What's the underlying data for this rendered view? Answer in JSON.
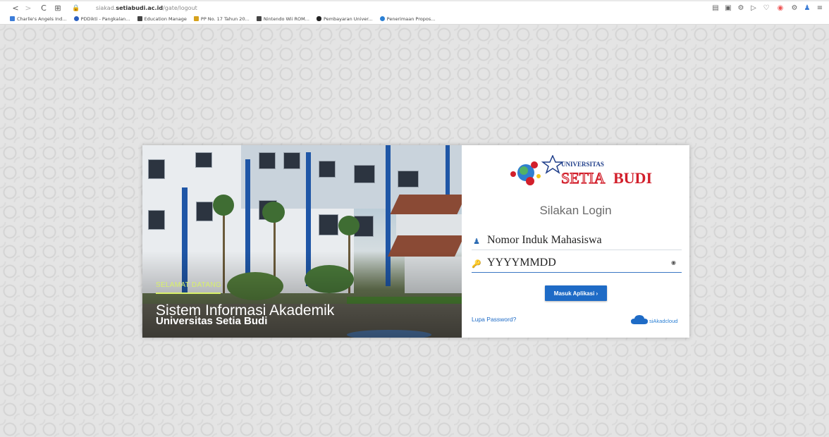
{
  "browser": {
    "nav": {
      "back": "<",
      "forward": ">",
      "reload": "C",
      "apps": "⊞"
    },
    "url_prefix": "siakad.",
    "url_domain": "setiabudi.ac.id",
    "url_path": "/gate/logout",
    "bookmarks": [
      {
        "label": "Charlie's Angels Ind...",
        "color": "#3c7dd9"
      },
      {
        "label": "PDDikti - Pangkalan...",
        "color": "#2b5fbf"
      },
      {
        "label": "Education Manage",
        "color": "#444444"
      },
      {
        "label": "PP No. 17 Tahun 20...",
        "color": "#d6a21d"
      },
      {
        "label": "Nintendo Wii ROM...",
        "color": "#444444"
      },
      {
        "label": "Pembayaran Univer...",
        "color": "#222222"
      },
      {
        "label": "Penerimaan Propos...",
        "color": "#2a7fd4"
      }
    ]
  },
  "hero": {
    "welcome": "SELAMAT DATANG",
    "system_title": "Sistem Informasi Akademik",
    "university": "Universitas Setia Budi"
  },
  "login": {
    "logo_top": "UNIVERSITAS",
    "logo_main_left": "SETIA",
    "logo_main_right": "BUDI",
    "heading": "Silakan Login",
    "username_placeholder": "Nomor Induk Mahasiswa",
    "password_placeholder": "YYYYMMDD",
    "submit_label": "Masuk Aplikasi ›",
    "forgot_label": "Lupa Password?",
    "brand_small": "siAkadcloud"
  },
  "colors": {
    "accent": "#1e6bc6",
    "welcome": "#d9f06a",
    "logo_red": "#d21f2b"
  }
}
